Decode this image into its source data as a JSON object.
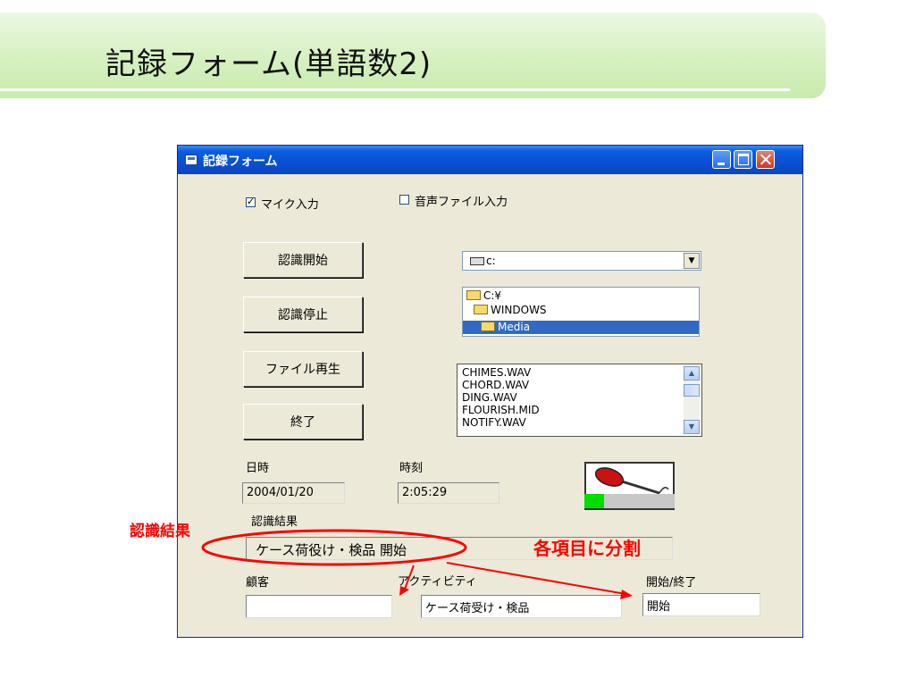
{
  "slide": {
    "title": "記録フォーム(単語数2)"
  },
  "window": {
    "title": "記録フォーム",
    "mic_input": {
      "label": "マイク入力",
      "checked": true
    },
    "file_input": {
      "label": "音声ファイル入力",
      "checked": false
    },
    "buttons": {
      "start": "認識開始",
      "stop": "認識停止",
      "play": "ファイル再生",
      "exit": "終了"
    },
    "drive": {
      "value": "c:"
    },
    "folders": [
      {
        "label": "C:¥",
        "selected": false
      },
      {
        "label": "WINDOWS",
        "selected": false
      },
      {
        "label": "Media",
        "selected": true
      }
    ],
    "files": [
      "CHIMES.WAV",
      "CHORD.WAV",
      "DING.WAV",
      "FLOURISH.MID",
      "NOTIFY.WAV"
    ],
    "date": {
      "label": "日時",
      "value": "2004/01/20"
    },
    "time": {
      "label": "時刻",
      "value": "2:05:29"
    },
    "audio_level": 0.22,
    "result": {
      "label": "認識結果",
      "value": "ケース荷役け・検品 開始"
    },
    "customer": {
      "label": "顧客",
      "value": ""
    },
    "activity": {
      "label": "アクティビティ",
      "value": "ケース荷受け・検品"
    },
    "start_end": {
      "label": "開始/終了",
      "value": "開始"
    }
  },
  "annotations": {
    "result_callout": "認識結果",
    "split_callout": "各項目に分割",
    "color": "#ff0000"
  }
}
